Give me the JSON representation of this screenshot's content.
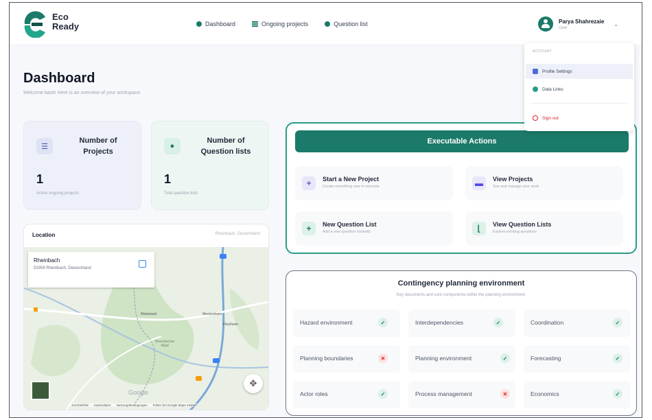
{
  "header": {
    "logo_line1": "Eco",
    "logo_line2": "Ready",
    "nav": [
      {
        "label": "Dashboard",
        "icon": "dashboard-dot-icon"
      },
      {
        "label": "Ongoing projects",
        "icon": "list-icon"
      },
      {
        "label": "Question list",
        "icon": "question-dot-icon"
      }
    ],
    "user_name": "Parya Shahrezaie",
    "user_role": "User"
  },
  "page": {
    "title": "Dashboard",
    "subtitle": "Welcome back! Here is an overview of your workspace."
  },
  "stats": [
    {
      "title": "Number of Projects",
      "value": "1",
      "note": "Active ongoing projects",
      "icon": "list-icon"
    },
    {
      "title": "Number of Question lists",
      "value": "1",
      "note": "Total question lists",
      "icon": "pin-icon"
    }
  ],
  "map": {
    "title": "Location",
    "location_label": "Rheinbach, Deutschland",
    "popup_name": "Rheinbach",
    "popup_address": "53359 Rheinbach, Deutschland",
    "places": [
      "Rheinbach",
      "Meckenheim",
      "Flerzheim",
      "Rheinbacher Wald"
    ],
    "google": "Google",
    "attribution": [
      "Kurzbefehle",
      "Kartendaten",
      "Nutzungsbedingungen",
      "Fehler bei Google Maps melden"
    ]
  },
  "actions": {
    "header": "Executable Actions",
    "items": [
      {
        "title": "Start a New Project",
        "sub": "Create something new in seconds",
        "icon": "plus-icon",
        "color": "#5b5fc7",
        "bg": "#e6e7fa"
      },
      {
        "title": "View Projects",
        "sub": "See and manage your work",
        "icon": "folder-icon",
        "color": "#4f46e5",
        "bg": "#e6e7fa"
      },
      {
        "title": "New Question List",
        "sub": "Add a new question instantly",
        "icon": "plus-icon",
        "color": "#1b7a6a",
        "bg": "#dcf1e8"
      },
      {
        "title": "View Question Lists",
        "sub": "Explore existing questions",
        "icon": "chart-icon",
        "color": "#1b7a6a",
        "bg": "#dcf1e8"
      }
    ]
  },
  "contingency": {
    "title": "Contingency planning environment",
    "subtitle": "Key documents and core components within the planning environment.",
    "items": [
      {
        "label": "Hazard environment",
        "status": "ok",
        "mark": "✓"
      },
      {
        "label": "Interdependencies",
        "status": "ok",
        "mark": "✓"
      },
      {
        "label": "Coordination",
        "status": "ok",
        "mark": "✓"
      },
      {
        "label": "Planning boundaries",
        "status": "no",
        "mark": "✕"
      },
      {
        "label": "Planning environment",
        "status": "ok",
        "mark": "✓"
      },
      {
        "label": "Forecasting",
        "status": "ok",
        "mark": "✓"
      },
      {
        "label": "Actor roles",
        "status": "ok",
        "mark": "✓"
      },
      {
        "label": "Process management",
        "status": "no",
        "mark": "✕"
      },
      {
        "label": "Economics",
        "status": "ok",
        "mark": "✓"
      }
    ]
  },
  "menu": {
    "section": "ACCOUNT",
    "profile": "Profile Settings",
    "data_links": "Data Links",
    "sign_out": "Sign out"
  }
}
